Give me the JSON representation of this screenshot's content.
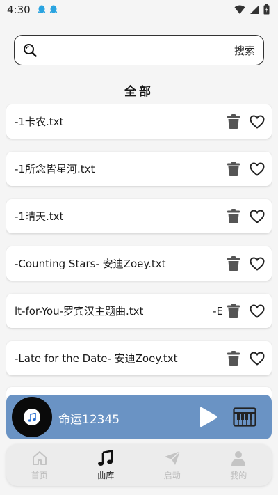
{
  "status": {
    "time": "4:30"
  },
  "search": {
    "placeholder": "",
    "value": "",
    "button_label": "搜索"
  },
  "section_title": "全部",
  "songs": [
    {
      "name": "-1卡农.txt"
    },
    {
      "name": "-1所念皆星河.txt"
    },
    {
      "name": "-1晴天.txt"
    },
    {
      "name": "-Counting Stars- 安迪Zoey.txt"
    },
    {
      "name": "lt-for-You-罗宾汉主题曲.txt",
      "overflow_tail": "-E"
    },
    {
      "name": "-Late for the Date- 安迪Zoey.txt"
    }
  ],
  "player": {
    "title": "命运12345"
  },
  "nav": {
    "items": [
      {
        "label": "首页",
        "icon": "home-icon",
        "active": false
      },
      {
        "label": "曲库",
        "icon": "music-note-icon",
        "active": true
      },
      {
        "label": "启动",
        "icon": "send-icon",
        "active": false
      },
      {
        "label": "我的",
        "icon": "person-icon",
        "active": false
      }
    ]
  },
  "colors": {
    "player_bg": "#6a93c4",
    "inactive_nav": "#bdbdbd",
    "icon_gray": "#555555"
  }
}
